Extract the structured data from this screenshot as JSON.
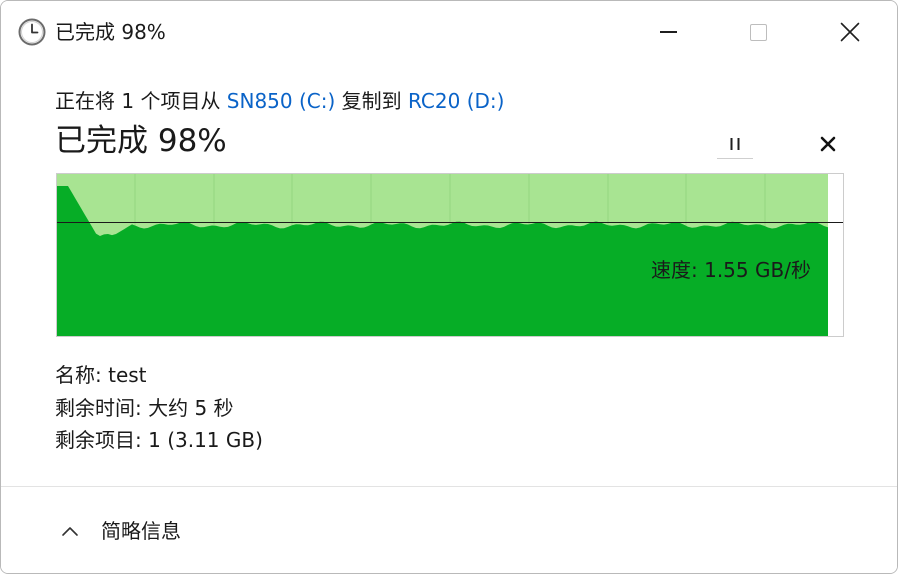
{
  "window": {
    "title": "已完成 98%",
    "icons": {
      "app": "clock-icon",
      "minimize": "minimize-icon",
      "maximize": "maximize-icon",
      "close": "close-icon"
    }
  },
  "copy": {
    "prefix": "正在将 1 个项目从 ",
    "source": "SN850 (C:)",
    "middle": " 复制到 ",
    "destination": "RC20 (D:)",
    "status": "已完成 98%",
    "pause_icon": "pause-icon",
    "cancel_icon": "cancel-x-icon"
  },
  "graph": {
    "speed_label": "速度: 1.55 GB/秒",
    "progress": 0.98,
    "speed_level": 0.7,
    "colors": {
      "remaining": "#ffffff",
      "completed": "#a8e492",
      "speed_fill": "#06ad26",
      "speed_line": "#1a1a1a",
      "grid": "#94d680",
      "border": "#cccccc"
    }
  },
  "details": {
    "name_label": "名称: ",
    "name_value": "test",
    "time_label": "剩余时间: ",
    "time_value": "大约 5 秒",
    "items_label": "剩余项目: ",
    "items_value": "1 (3.11 GB)"
  },
  "footer": {
    "less_info": "简略信息",
    "icon": "chevron-up-icon"
  }
}
